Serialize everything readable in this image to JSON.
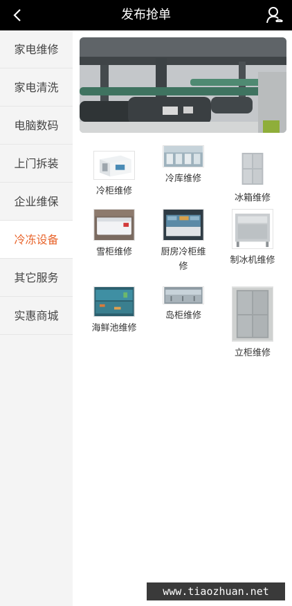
{
  "header": {
    "title": "发布抢单",
    "back_icon": "chevron-left-icon",
    "user_icon": "user-icon"
  },
  "sidebar": {
    "items": [
      {
        "label": "家电维修",
        "active": false
      },
      {
        "label": "家电清洗",
        "active": false
      },
      {
        "label": "电脑数码",
        "active": false
      },
      {
        "label": "上门拆装",
        "active": false
      },
      {
        "label": "企业维保",
        "active": false
      },
      {
        "label": "冷冻设备",
        "active": true
      },
      {
        "label": "其它服务",
        "active": false
      },
      {
        "label": "实惠商城",
        "active": false
      }
    ]
  },
  "services": [
    {
      "label": "冷柜维修",
      "image": "cold-room-image"
    },
    {
      "label": "冷库维修",
      "image": "cold-storage-image"
    },
    {
      "label": "冰箱维修",
      "image": "fridge-image"
    },
    {
      "label": "雪柜维修",
      "image": "chest-freezer-image"
    },
    {
      "label": "厨房冷柜维修",
      "image": "kitchen-freezer-image"
    },
    {
      "label": "制冰机维修",
      "image": "ice-machine-image"
    },
    {
      "label": "海鲜池维修",
      "image": "seafood-tank-image"
    },
    {
      "label": "岛柜维修",
      "image": "island-freezer-image"
    },
    {
      "label": "立柜维修",
      "image": "upright-freezer-image"
    }
  ],
  "watermark": "www.tiaozhuan.net",
  "colors": {
    "header_bg": "#000000",
    "active_accent": "#e8632a",
    "sidebar_bg": "#f4f4f4"
  }
}
